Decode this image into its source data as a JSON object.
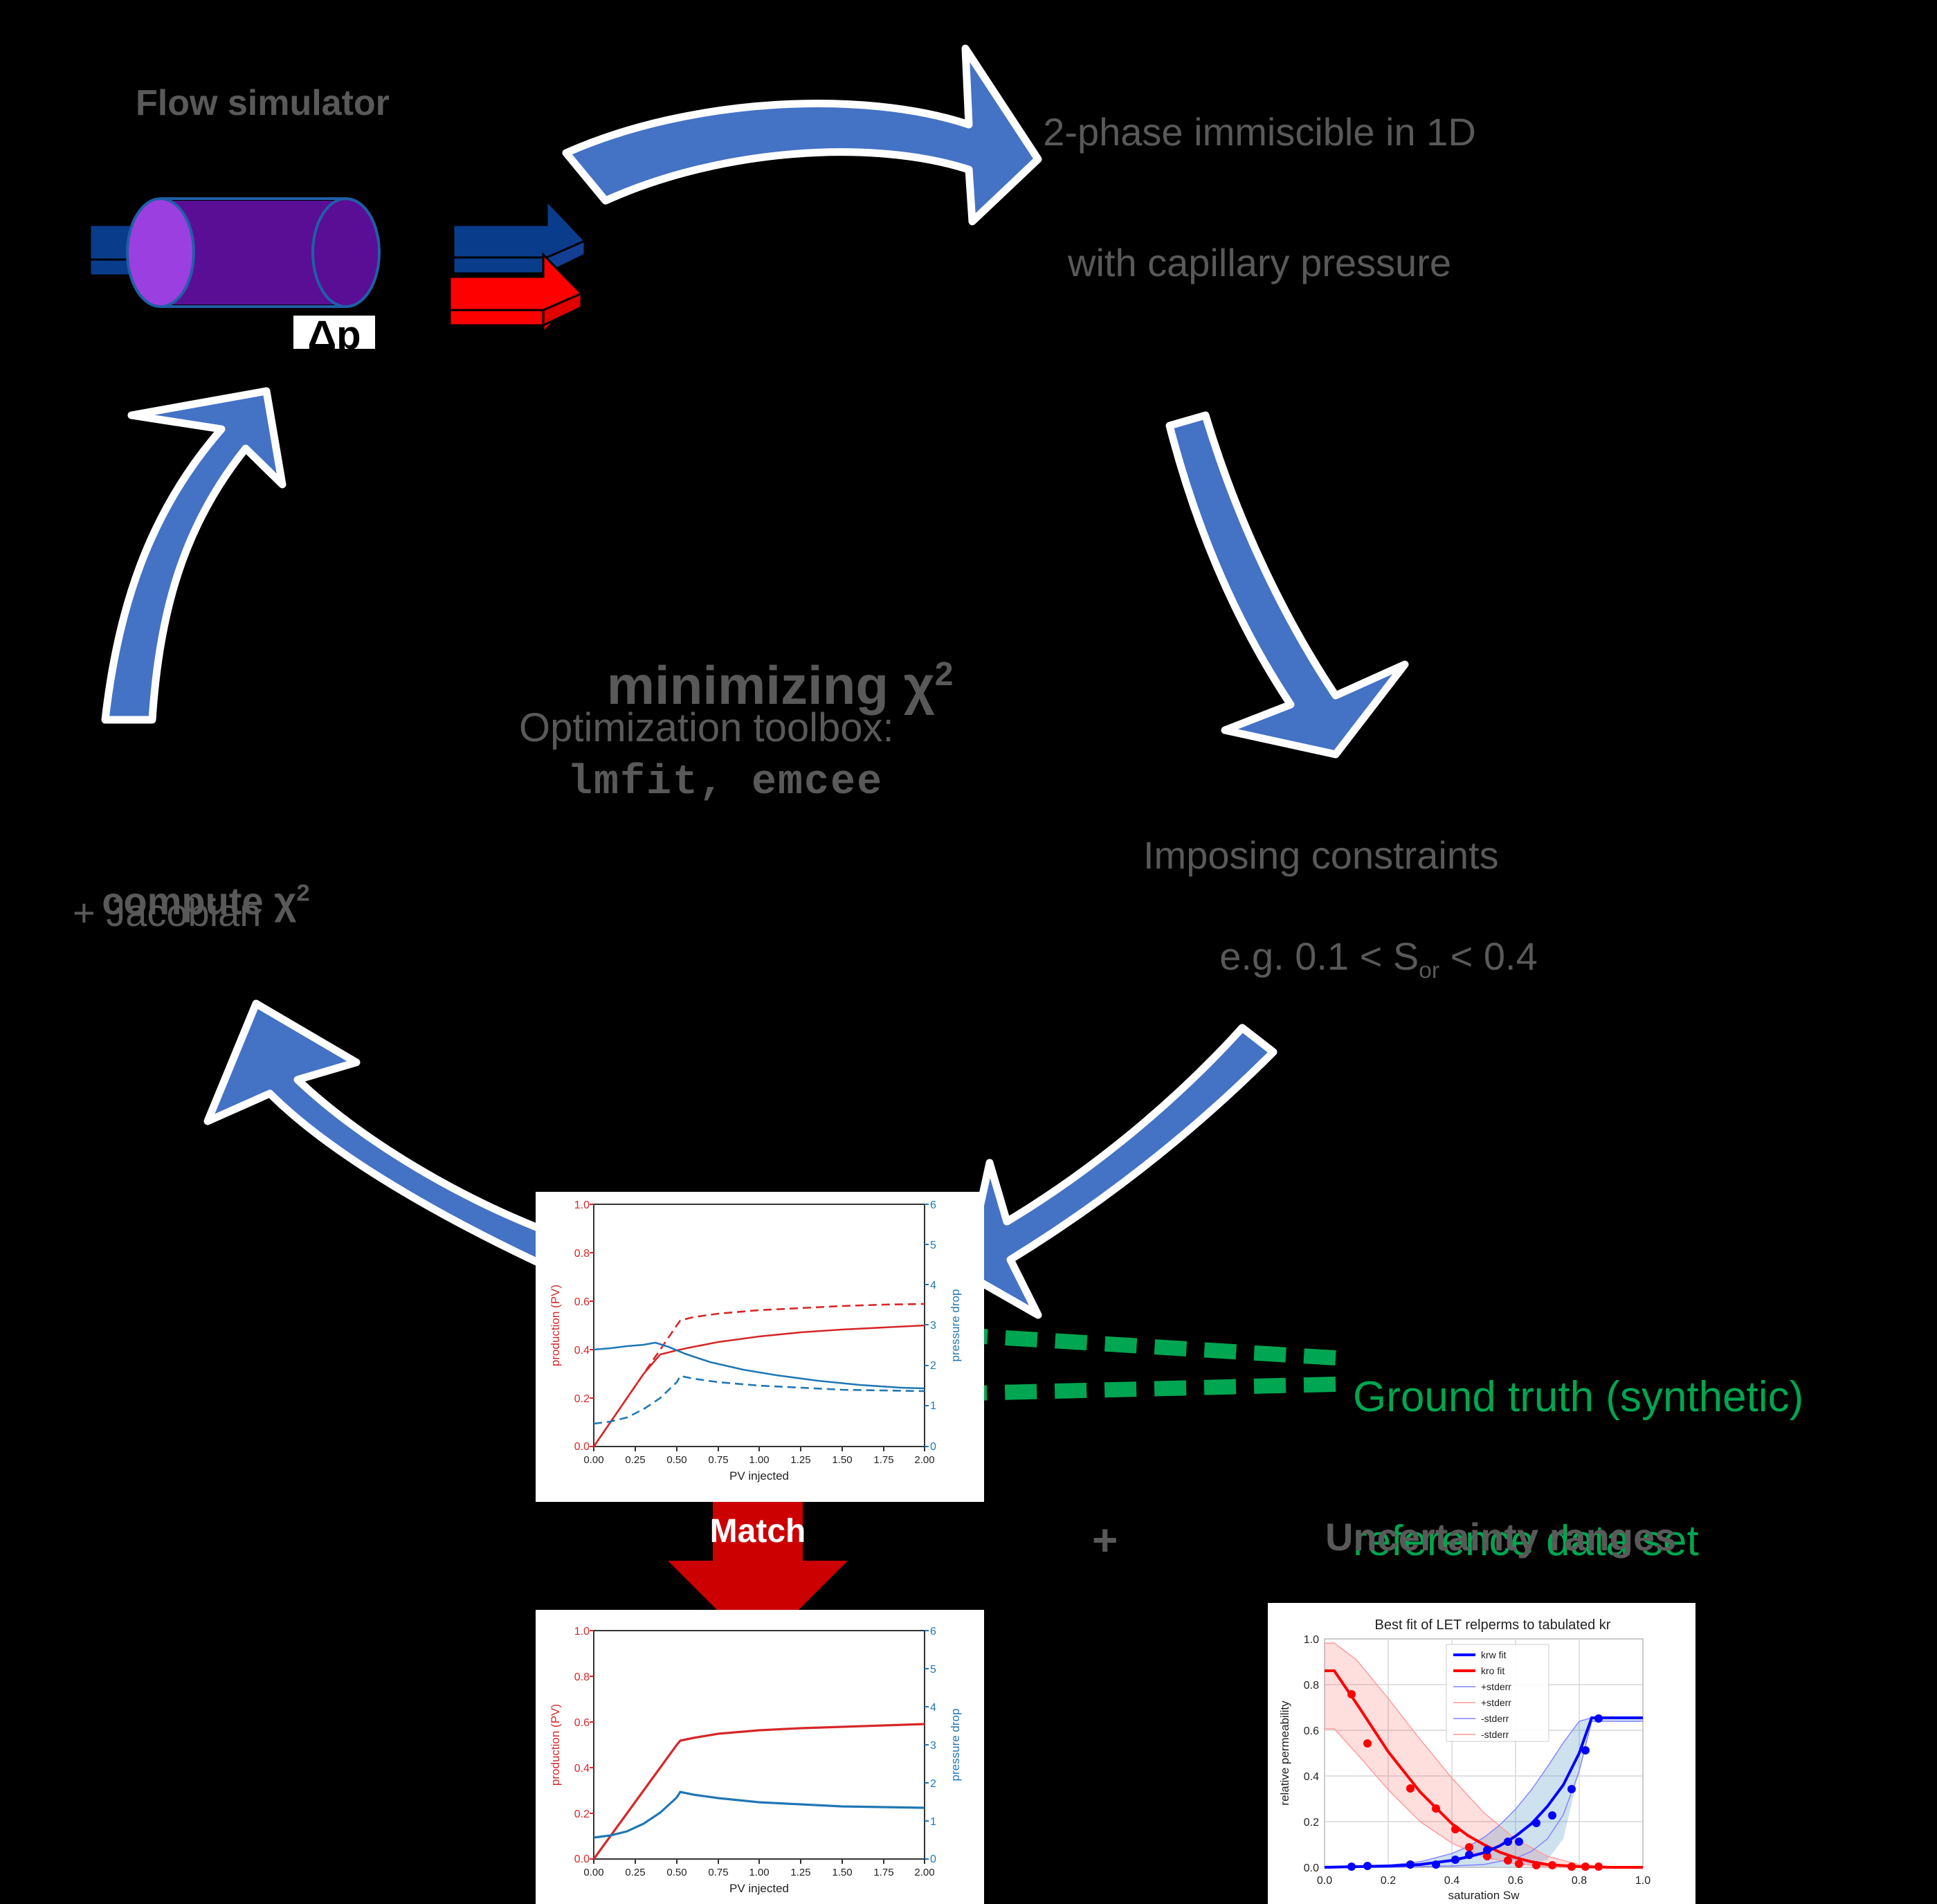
{
  "diagram": {
    "title_flow_simulator": "Flow simulator",
    "cylinder_label": "Δp",
    "model_desc_line1": "2-phase immiscible in 1D",
    "model_desc_line2": "with capillary pressure",
    "center_title": "minimizing χ",
    "center_title_sup": "2",
    "center_sub1": "Optimization toolbox:",
    "center_sub2": "lmfit, emcee",
    "compute_line1_a": "compute χ",
    "compute_line1_sup": "2",
    "compute_line2": "+ Jacobian",
    "constraints_line1": "Imposing constraints",
    "constraints_line2_a": "e.g. 0.1 < S",
    "constraints_line2_sub": "or",
    "constraints_line2_b": " < 0.4",
    "ground_truth_line1": "Ground truth (synthetic)",
    "ground_truth_line2": "reference data set",
    "match_label": "Match",
    "plus_label": "+",
    "uncertainty_label": "Uncertainty ranges"
  },
  "colors": {
    "arrow_blue": "#4472C4",
    "arrow_blue_outline": "#FFFFFF",
    "solid_blue": "#0A3C8C",
    "solid_red": "#FF0000",
    "match_red": "#CC0000",
    "green": "#00A651",
    "gray_text": "#595959",
    "cylinder_body": "#5A0E96",
    "cylinder_cap": "#9B3FE0",
    "cylinder_stroke": "#1F5FA8",
    "chart_red": "#D62728",
    "chart_blue": "#1F77B4",
    "relperm_krw": "#0000FF",
    "relperm_kro": "#FF0000"
  },
  "chart_data": [
    {
      "id": "ground-truth-production",
      "type": "line",
      "title": "",
      "xlabel": "PV injected",
      "ylabel_left": "production (PV)",
      "ylabel_right": "pressure drop",
      "xlim": [
        0,
        2
      ],
      "ylim_left": [
        0,
        1
      ],
      "ylim_right": [
        0,
        6
      ],
      "xticks": [
        "0.00",
        "0.25",
        "0.50",
        "0.75",
        "1.00",
        "1.25",
        "1.50",
        "1.75",
        "2.00"
      ],
      "yticks_left": [
        "0.0",
        "0.2",
        "0.4",
        "0.6",
        "0.8",
        "1.0"
      ],
      "yticks_right": [
        "0",
        "1",
        "2",
        "3",
        "4",
        "5",
        "6"
      ],
      "grid": false,
      "legend": "none",
      "series": [
        {
          "name": "production simulated",
          "axis": "left",
          "color": "#D62728",
          "style": "solid",
          "x": [
            0.0,
            0.1,
            0.2,
            0.3,
            0.4,
            0.5,
            0.6,
            0.75,
            1.0,
            1.25,
            1.5,
            1.75,
            2.0
          ],
          "y": [
            0.0,
            0.1,
            0.2,
            0.3,
            0.38,
            0.398,
            0.412,
            0.432,
            0.455,
            0.472,
            0.483,
            0.492,
            0.5
          ]
        },
        {
          "name": "production reference",
          "axis": "left",
          "color": "#D62728",
          "style": "dashed",
          "x": [
            0.0,
            0.1,
            0.2,
            0.3,
            0.4,
            0.5,
            0.52,
            0.6,
            0.75,
            1.0,
            1.25,
            1.5,
            1.75,
            2.0
          ],
          "y": [
            0.0,
            0.1,
            0.2,
            0.3,
            0.4,
            0.5,
            0.52,
            0.533,
            0.548,
            0.562,
            0.572,
            0.58,
            0.585,
            0.59
          ]
        },
        {
          "name": "pressure drop simulated",
          "axis": "right",
          "color": "#1F77B4",
          "style": "solid",
          "x": [
            0.0,
            0.1,
            0.2,
            0.3,
            0.37,
            0.45,
            0.55,
            0.7,
            0.9,
            1.1,
            1.35,
            1.6,
            1.85,
            2.0
          ],
          "y": [
            2.4,
            2.43,
            2.48,
            2.53,
            2.58,
            2.47,
            2.3,
            2.1,
            1.92,
            1.78,
            1.65,
            1.55,
            1.48,
            1.45
          ]
        },
        {
          "name": "pressure drop reference",
          "axis": "right",
          "color": "#1F77B4",
          "style": "dashed",
          "x": [
            0.0,
            0.1,
            0.2,
            0.3,
            0.4,
            0.5,
            0.52,
            0.6,
            0.75,
            1.0,
            1.25,
            1.5,
            1.75,
            2.0
          ],
          "y": [
            0.56,
            0.62,
            0.72,
            0.92,
            1.2,
            1.6,
            1.75,
            1.68,
            1.6,
            1.52,
            1.46,
            1.42,
            1.39,
            1.38
          ]
        }
      ]
    },
    {
      "id": "matched-production",
      "type": "line",
      "title": "",
      "xlabel": "PV injected",
      "ylabel_left": "production (PV)",
      "ylabel_right": "pressure drop",
      "xlim": [
        0,
        2
      ],
      "ylim_left": [
        0,
        1
      ],
      "ylim_right": [
        0,
        6
      ],
      "xticks": [
        "0.00",
        "0.25",
        "0.50",
        "0.75",
        "1.00",
        "1.25",
        "1.50",
        "1.75",
        "2.00"
      ],
      "yticks_left": [
        "0.0",
        "0.2",
        "0.4",
        "0.6",
        "0.8",
        "1.0"
      ],
      "yticks_right": [
        "0",
        "1",
        "2",
        "3",
        "4",
        "5",
        "6"
      ],
      "grid": false,
      "legend": "none",
      "series": [
        {
          "name": "production matched",
          "axis": "left",
          "color": "#D62728",
          "style": "solid",
          "x": [
            0.0,
            0.1,
            0.2,
            0.3,
            0.4,
            0.5,
            0.52,
            0.6,
            0.75,
            1.0,
            1.25,
            1.5,
            1.75,
            2.0
          ],
          "y": [
            0.0,
            0.1,
            0.2,
            0.3,
            0.4,
            0.5,
            0.518,
            0.532,
            0.548,
            0.562,
            0.572,
            0.58,
            0.585,
            0.59
          ]
        },
        {
          "name": "pressure drop matched",
          "axis": "right",
          "color": "#1F77B4",
          "style": "solid",
          "x": [
            0.0,
            0.1,
            0.2,
            0.3,
            0.4,
            0.5,
            0.52,
            0.6,
            0.75,
            1.0,
            1.25,
            1.5,
            1.75,
            2.0
          ],
          "y": [
            0.56,
            0.62,
            0.72,
            0.92,
            1.2,
            1.62,
            1.77,
            1.68,
            1.6,
            1.52,
            1.46,
            1.42,
            1.39,
            1.38
          ]
        }
      ]
    },
    {
      "id": "let-relperm-fit",
      "type": "line",
      "title": "Best fit of LET relperms to tabulated kr",
      "xlabel": "saturation Sw",
      "ylabel": "relative permeability",
      "xlim": [
        0,
        1
      ],
      "ylim": [
        0,
        1
      ],
      "xticks": [
        "0.0",
        "0.2",
        "0.4",
        "0.6",
        "0.8",
        "1.0"
      ],
      "yticks": [
        "0.0",
        "0.2",
        "0.4",
        "0.6",
        "0.8",
        "1.0"
      ],
      "grid": true,
      "legend": "upper center",
      "legend_entries": [
        "krw fit",
        "kro fit",
        "+stderr",
        "+stderr",
        "-stderr",
        "-stderr"
      ],
      "legend_colors": [
        "#0000FF",
        "#FF0000",
        "#8080FF",
        "#FF9999",
        "#8080FF",
        "#FF9999"
      ],
      "series": [
        {
          "name": "krw fit",
          "color": "#0000FF",
          "style": "solid",
          "width": 3,
          "x": [
            0.0,
            0.1,
            0.2,
            0.3,
            0.4,
            0.45,
            0.5,
            0.55,
            0.6,
            0.65,
            0.7,
            0.75,
            0.8,
            0.84,
            0.9,
            1.0
          ],
          "y": [
            0.0,
            0.003,
            0.006,
            0.012,
            0.03,
            0.045,
            0.065,
            0.095,
            0.135,
            0.19,
            0.265,
            0.36,
            0.5,
            0.655,
            0.655,
            0.655
          ]
        },
        {
          "name": "kro fit",
          "color": "#FF0000",
          "style": "solid",
          "width": 3,
          "x": [
            0.0,
            0.03,
            0.1,
            0.2,
            0.3,
            0.4,
            0.45,
            0.5,
            0.55,
            0.6,
            0.65,
            0.7,
            0.8,
            0.9,
            1.0
          ],
          "y": [
            0.86,
            0.86,
            0.72,
            0.505,
            0.33,
            0.19,
            0.14,
            0.1,
            0.068,
            0.042,
            0.025,
            0.013,
            0.003,
            0.0,
            0.0
          ]
        },
        {
          "name": "krw +stderr",
          "color": "#8080FF",
          "style": "solid",
          "width": 1,
          "x": [
            0.0,
            0.2,
            0.3,
            0.4,
            0.45,
            0.5,
            0.55,
            0.6,
            0.65,
            0.7,
            0.75,
            0.8,
            0.84,
            1.0
          ],
          "y": [
            0.0,
            0.01,
            0.025,
            0.06,
            0.09,
            0.13,
            0.185,
            0.255,
            0.34,
            0.44,
            0.545,
            0.64,
            0.655,
            0.655
          ]
        },
        {
          "name": "krw -stderr",
          "color": "#8080FF",
          "style": "solid",
          "width": 1,
          "x": [
            0.0,
            0.2,
            0.3,
            0.4,
            0.5,
            0.6,
            0.65,
            0.7,
            0.75,
            0.8,
            0.84,
            0.9,
            1.0
          ],
          "y": [
            0.0,
            0.001,
            0.002,
            0.005,
            0.013,
            0.04,
            0.07,
            0.125,
            0.23,
            0.42,
            0.64,
            0.64,
            0.64
          ]
        },
        {
          "name": "kro +stderr",
          "color": "#FF9999",
          "style": "solid",
          "width": 1,
          "x": [
            0.0,
            0.03,
            0.1,
            0.2,
            0.3,
            0.4,
            0.5,
            0.6,
            0.7,
            0.8,
            0.9,
            1.0
          ],
          "y": [
            0.98,
            0.98,
            0.9,
            0.74,
            0.56,
            0.39,
            0.24,
            0.125,
            0.05,
            0.012,
            0.001,
            0.0
          ]
        },
        {
          "name": "kro -stderr",
          "color": "#FF9999",
          "style": "solid",
          "width": 1,
          "x": [
            0.0,
            0.03,
            0.1,
            0.2,
            0.3,
            0.4,
            0.5,
            0.6,
            0.7,
            0.8,
            0.9,
            1.0
          ],
          "y": [
            0.605,
            0.605,
            0.5,
            0.34,
            0.2,
            0.105,
            0.045,
            0.015,
            0.003,
            0.0,
            0.0,
            0.0
          ]
        }
      ],
      "points": [
        {
          "name": "kro data",
          "color": "#FF0000",
          "x": [
            0.085,
            0.135,
            0.27,
            0.35,
            0.41,
            0.455,
            0.51,
            0.575,
            0.61,
            0.665,
            0.715,
            0.775,
            0.82,
            0.86
          ],
          "y": [
            0.757,
            0.543,
            0.345,
            0.258,
            0.168,
            0.087,
            0.048,
            0.03,
            0.015,
            0.01,
            0.008,
            0.003,
            0.003,
            0.003
          ]
        },
        {
          "name": "krw data",
          "color": "#0000FF",
          "x": [
            0.085,
            0.135,
            0.27,
            0.35,
            0.41,
            0.455,
            0.51,
            0.575,
            0.61,
            0.665,
            0.715,
            0.775,
            0.82,
            0.86
          ],
          "y": [
            0.003,
            0.005,
            0.012,
            0.013,
            0.033,
            0.053,
            0.075,
            0.113,
            0.113,
            0.193,
            0.228,
            0.343,
            0.513,
            0.653
          ]
        }
      ]
    }
  ]
}
